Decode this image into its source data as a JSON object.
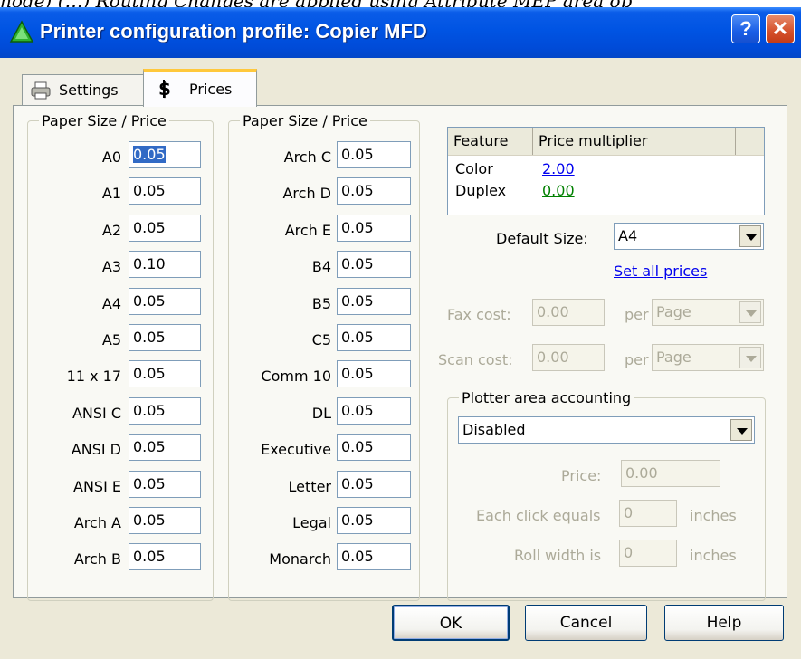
{
  "background_text": "node) (…) Routing Changes are applied using Attribute MEP area op",
  "window": {
    "title": "Printer configuration profile: Copier MFD",
    "help_button": "?",
    "close_button": "✕"
  },
  "tabs": [
    {
      "label": "Settings",
      "icon": "printer-icon",
      "selected": false
    },
    {
      "label": "Prices",
      "icon": "money-icon",
      "selected": true
    }
  ],
  "paper_group_1": {
    "title": "Paper Size / Price",
    "rows": [
      {
        "label": "A0",
        "value": "0.05",
        "selected": true
      },
      {
        "label": "A1",
        "value": "0.05"
      },
      {
        "label": "A2",
        "value": "0.05"
      },
      {
        "label": "A3",
        "value": "0.10"
      },
      {
        "label": "A4",
        "value": "0.05"
      },
      {
        "label": "A5",
        "value": "0.05"
      },
      {
        "label": "11 x 17",
        "value": "0.05"
      },
      {
        "label": "ANSI C",
        "value": "0.05"
      },
      {
        "label": "ANSI D",
        "value": "0.05"
      },
      {
        "label": "ANSI E",
        "value": "0.05"
      },
      {
        "label": "Arch A",
        "value": "0.05"
      },
      {
        "label": "Arch B",
        "value": "0.05"
      }
    ]
  },
  "paper_group_2": {
    "title": "Paper Size / Price",
    "rows": [
      {
        "label": "Arch C",
        "value": "0.05"
      },
      {
        "label": "Arch D",
        "value": "0.05"
      },
      {
        "label": "Arch E",
        "value": "0.05"
      },
      {
        "label": "B4",
        "value": "0.05"
      },
      {
        "label": "B5",
        "value": "0.05"
      },
      {
        "label": "C5",
        "value": "0.05"
      },
      {
        "label": "Comm 10",
        "value": "0.05"
      },
      {
        "label": "DL",
        "value": "0.05"
      },
      {
        "label": "Executive",
        "value": "0.05"
      },
      {
        "label": "Letter",
        "value": "0.05"
      },
      {
        "label": "Legal",
        "value": "0.05"
      },
      {
        "label": "Monarch",
        "value": "0.05"
      }
    ]
  },
  "feature_table": {
    "headers": [
      "Feature",
      "Price multiplier"
    ],
    "rows": [
      {
        "feature": "Color",
        "multiplier": "2.00",
        "color": "#0000ee"
      },
      {
        "feature": "Duplex",
        "multiplier": "0.00",
        "color": "#008000"
      }
    ]
  },
  "default_size": {
    "label": "Default Size:",
    "value": "A4"
  },
  "set_all_prices": "Set all prices",
  "fax": {
    "label": "Fax cost:",
    "value": "0.00",
    "per": "per",
    "unit": "Page"
  },
  "scan": {
    "label": "Scan cost:",
    "value": "0.00",
    "per": "per",
    "unit": "Page"
  },
  "plotter": {
    "title": "Plotter area accounting",
    "mode": "Disabled",
    "price_label": "Price:",
    "price_value": "0.00",
    "click_label": "Each click equals",
    "click_value": "0",
    "click_unit": "inches",
    "roll_label": "Roll width is",
    "roll_value": "0",
    "roll_unit": "inches"
  },
  "buttons": {
    "ok": "OK",
    "cancel": "Cancel",
    "help": "Help"
  }
}
